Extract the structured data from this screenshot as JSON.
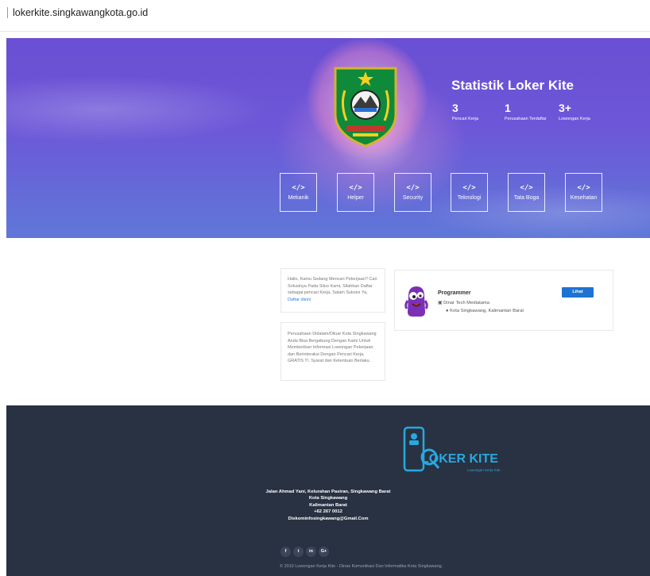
{
  "browser": {
    "url": "lokerkite.singkawangkota.go.id"
  },
  "hero": {
    "title": "Statistik Loker Kite",
    "stats": [
      {
        "value": "3",
        "label": "Pencari Kerja"
      },
      {
        "value": "1",
        "label": "Perusahaan Terdaftar"
      },
      {
        "value": "3+",
        "label": "Lowongan Kerja"
      }
    ],
    "category_icon": "</>",
    "categories": [
      "Mekanik",
      "Helper",
      "Security",
      "Teknologi",
      "Tata Boga",
      "Kesehatan"
    ]
  },
  "intro": {
    "text": "Hallo, Kamu Sedang Mencari Pekerjaan? Cari Solusinya Pada Situs Kami, Silahkan Daftar sebagai pencari Kerja, Salam Sukses Ya,",
    "link": "Daftar disini"
  },
  "info": {
    "text": "Perusahaan Didalam/Diluar Kota Singkawang Anda Bisa Bergabung Dengan Kami Untuk Memberikan Informasi Lowongan Pekerjaan dan Berinteraksi Dengan Pencari Kerja, GRATIS !!!, Syarat dan Ketentuan Berlaku."
  },
  "job": {
    "title": "Programmer",
    "company": "Dinar Tech Mediatama",
    "location": "Kota Singkawang, Kalimantan Barat",
    "button": "Lihat"
  },
  "footer": {
    "logo_text": "LOKER KITE",
    "logo_tagline": "Lowongan Kerja Kite",
    "address_lines": [
      "Jalan Ahmad Yani, Kelurahan Pasiran, Singkawang Barat",
      "Kota Singkawang",
      "Kalimantan Barat",
      "+62 267 0012",
      "Diskominfosingkawang@Gmail.Com"
    ],
    "social": [
      "f",
      "t",
      "in",
      "G+"
    ],
    "copyright": "© 2019 Lowongan Kerja Kite - Dinas Komunikasi Dan Informatika Kota Singkawang."
  },
  "colors": {
    "hero_top": "#6a4fd3",
    "hero_bottom": "#5f78d8",
    "footer_bg": "#283242",
    "button": "#1e73d2",
    "link": "#2b7ad9"
  }
}
